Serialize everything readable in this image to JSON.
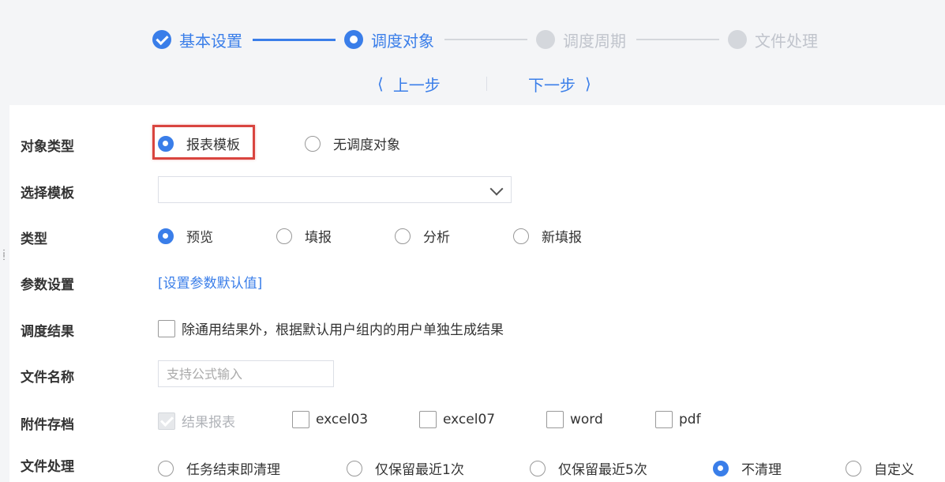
{
  "steps": [
    {
      "label": "基本设置",
      "state": "done"
    },
    {
      "label": "调度对象",
      "state": "active"
    },
    {
      "label": "调度周期",
      "state": "todo"
    },
    {
      "label": "文件处理",
      "state": "todo"
    }
  ],
  "nav": {
    "prev": "上一步",
    "next": "下一步",
    "prev_icon": "chevron-left-icon",
    "next_icon": "chevron-right-icon"
  },
  "form": {
    "object_type": {
      "label": "对象类型",
      "options": [
        "报表模板",
        "无调度对象"
      ],
      "selected": "报表模板"
    },
    "template": {
      "label": "选择模板",
      "value": ""
    },
    "type": {
      "label": "类型",
      "options": [
        "预览",
        "填报",
        "分析",
        "新填报"
      ],
      "selected": "预览"
    },
    "params": {
      "label": "参数设置",
      "link": "[设置参数默认值]"
    },
    "result": {
      "label": "调度结果",
      "checkbox": "除通用结果外，根据默认用户组内的用户单独生成结果",
      "checked": false
    },
    "filename": {
      "label": "文件名称",
      "placeholder": "支持公式输入",
      "value": ""
    },
    "attachments": {
      "label": "附件存档",
      "options": [
        "结果报表",
        "excel03",
        "excel07",
        "word",
        "pdf"
      ],
      "disabled": "结果报表"
    },
    "file_handling": {
      "label": "文件处理",
      "options": [
        "任务结束即清理",
        "仅保留最近1次",
        "仅保留最近5次",
        "不清理",
        "自定义"
      ],
      "selected": "不清理"
    }
  },
  "colors": {
    "accent": "#3a7ee9",
    "highlight": "#d9453f"
  }
}
